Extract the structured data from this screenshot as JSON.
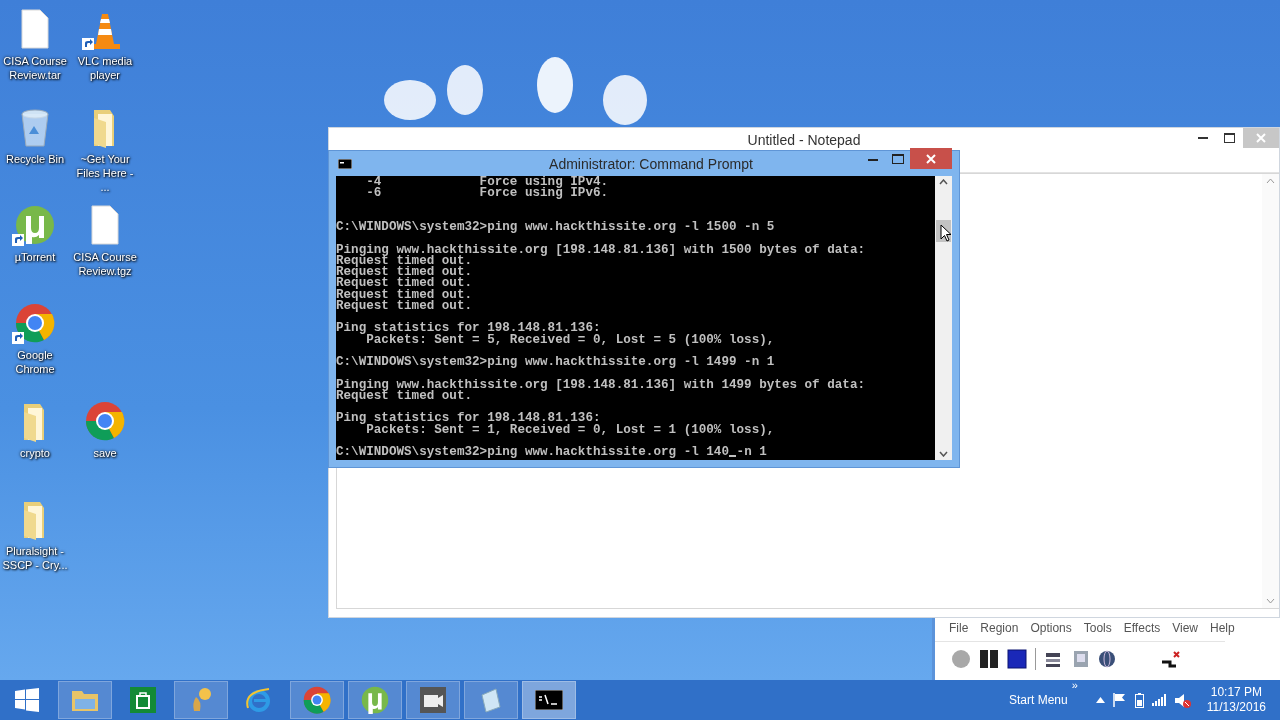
{
  "desktop": {
    "icon_rows": [
      [
        {
          "label": "CISA Course Review.tar",
          "kind": "file",
          "shortcut": false
        },
        {
          "label": "VLC media player",
          "kind": "vlc",
          "shortcut": true
        }
      ],
      [
        {
          "label": "Recycle Bin",
          "kind": "recycle",
          "shortcut": false
        },
        {
          "label": "~Get Your Files Here - ...",
          "kind": "folder",
          "shortcut": false
        }
      ],
      [
        {
          "label": "µTorrent",
          "kind": "utorrent",
          "shortcut": true
        },
        {
          "label": "CISA Course Review.tgz",
          "kind": "file",
          "shortcut": false
        }
      ],
      [
        {
          "label": "Google Chrome",
          "kind": "chrome",
          "shortcut": true
        }
      ],
      [
        {
          "label": "crypto",
          "kind": "folder",
          "shortcut": false
        },
        {
          "label": "save",
          "kind": "chrome",
          "shortcut": false
        }
      ],
      [
        {
          "label": "Pluralsight - SSCP - Cry...",
          "kind": "folder",
          "shortcut": false
        }
      ]
    ]
  },
  "notepad": {
    "title": "Untitled - Notepad"
  },
  "command_prompt": {
    "title": "Administrator: Command Prompt",
    "blocks": [
      [
        "    -4             Force using IPv4.",
        "    -6             Force using IPv6."
      ],
      [
        "C:\\WINDOWS\\system32>ping www.hackthissite.org -l 1500 -n 5"
      ],
      [
        "Pinging www.hackthissite.org [198.148.81.136] with 1500 bytes of data:",
        "Request timed out.",
        "Request timed out.",
        "Request timed out.",
        "Request timed out.",
        "Request timed out."
      ],
      [
        "Ping statistics for 198.148.81.136:",
        "    Packets: Sent = 5, Received = 0, Lost = 5 (100% loss),"
      ],
      [
        "C:\\WINDOWS\\system32>ping www.hackthissite.org -l 1499 -n 1"
      ],
      [
        "Pinging www.hackthissite.org [198.148.81.136] with 1499 bytes of data:",
        "Request timed out."
      ],
      [
        "Ping statistics for 198.148.81.136:",
        "    Packets: Sent = 1, Received = 0, Lost = 1 (100% loss),"
      ]
    ],
    "input_line": {
      "before_cursor": "C:\\WINDOWS\\system32>ping www.hackthissite.org -l 140",
      "after_cursor": "-n 1"
    }
  },
  "capture_tool": {
    "menu": [
      "File",
      "Region",
      "Options",
      "Tools",
      "Effects",
      "View",
      "Help"
    ],
    "tools": [
      {
        "kind": "record"
      },
      {
        "kind": "pause"
      },
      {
        "kind": "stop"
      },
      {
        "kind": "separator"
      },
      {
        "kind": "stack"
      },
      {
        "kind": "window"
      },
      {
        "kind": "web"
      },
      {
        "kind": "spacer"
      },
      {
        "kind": "cut"
      }
    ]
  },
  "taskbar": {
    "items": [
      {
        "kind": "start",
        "running": false,
        "selected": false
      },
      {
        "kind": "explorer",
        "running": true,
        "selected": false
      },
      {
        "kind": "store",
        "running": false,
        "selected": false
      },
      {
        "kind": "figure",
        "running": true,
        "selected": false
      },
      {
        "kind": "ie",
        "running": false,
        "selected": false
      },
      {
        "kind": "chrome",
        "running": true,
        "selected": false
      },
      {
        "kind": "utorrent",
        "running": true,
        "selected": false
      },
      {
        "kind": "camera",
        "running": true,
        "selected": false
      },
      {
        "kind": "notepad",
        "running": true,
        "selected": false
      },
      {
        "kind": "cmd",
        "running": true,
        "selected": true
      }
    ],
    "toolbar_label": "Start Menu",
    "toolbar_chevron": "»",
    "time": "10:17 PM",
    "date": "11/13/2016"
  }
}
